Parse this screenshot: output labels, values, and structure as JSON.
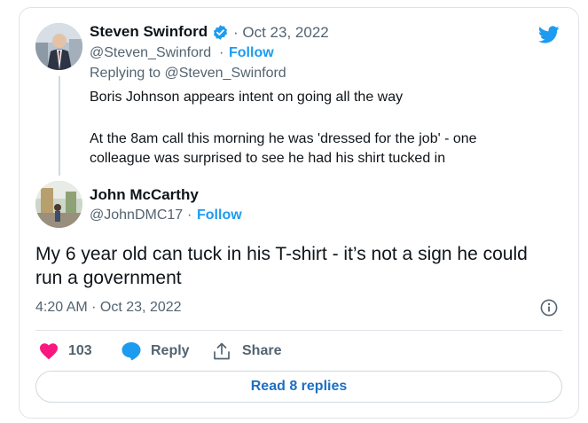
{
  "parent_tweet": {
    "name": "Steven Swinford",
    "date": "· Oct 23, 2022",
    "handle": "@Steven_Swinford",
    "separator": "·",
    "follow_label": "Follow",
    "replying_to": "Replying to @Steven_Swinford",
    "line1": "Boris Johnson appears intent on going all the way",
    "line2": "At the 8am call this morning he was 'dressed for the job' - one",
    "line3": "colleague was surprised to see he had his shirt tucked in"
  },
  "reply_tweet": {
    "name": "John McCarthy",
    "handle": "@JohnDMC17",
    "separator": "·",
    "follow_label": "Follow",
    "text": "My 6 year old can tuck in his T-shirt - it’s not a sign he could run a government",
    "timestamp": "4:20 AM · Oct 23, 2022"
  },
  "actions": {
    "like_count": "103",
    "reply_label": "Reply",
    "share_label": "Share"
  },
  "read_more_label": "Read 8 replies",
  "colors": {
    "accent": "#1d9bf0",
    "like": "#f91880",
    "reply_icon": "#1d9bf0",
    "verified": "#1d9bf0"
  },
  "icons": [
    "twitter-bird-icon",
    "verified-badge-icon",
    "heart-icon",
    "reply-bubble-icon",
    "share-icon",
    "info-icon"
  ]
}
